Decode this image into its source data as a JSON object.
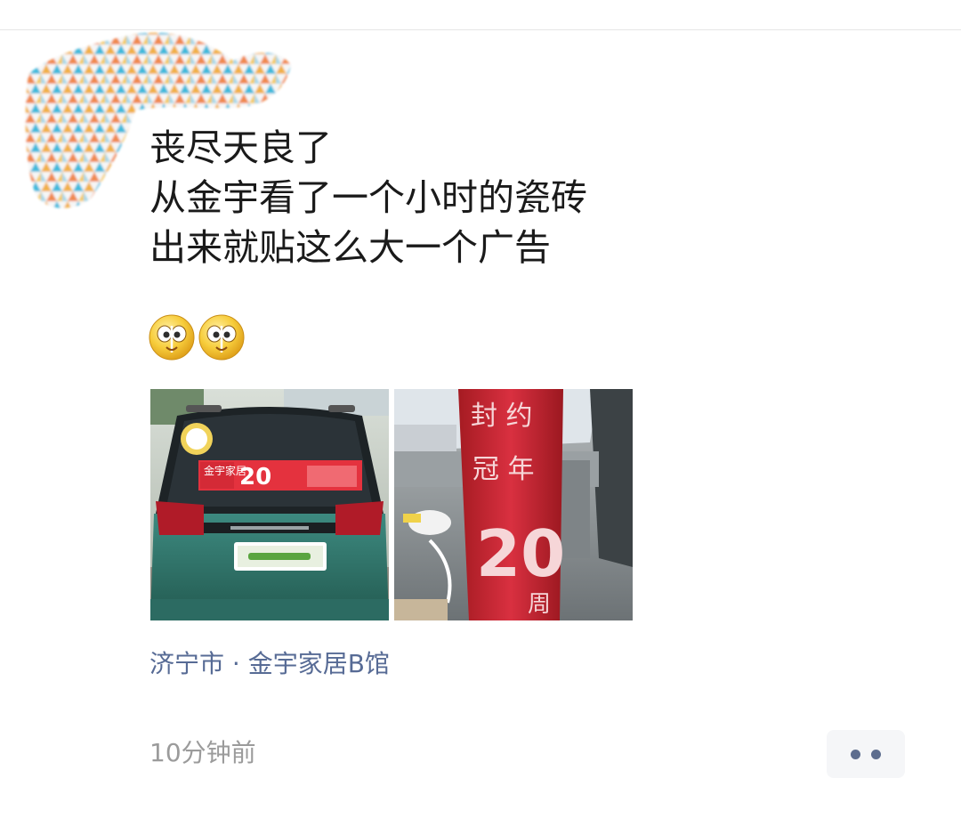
{
  "post": {
    "lines": [
      "丧尽天良了",
      "从金宇看了一个小时的瓷砖",
      "出来就贴这么大一个广告"
    ],
    "emojis": [
      "dizzy-face-emoji",
      "dizzy-face-emoji"
    ],
    "photos": [
      {
        "description": "car-rear-with-ad-sticker",
        "ad_brand": "金宇家居",
        "ad_number": "20"
      },
      {
        "description": "red-banner-in-car",
        "banner_number": "20",
        "banner_text": "周"
      }
    ],
    "location": "济宁市 · 金宇家居B馆",
    "timestamp": "10分钟前"
  },
  "colors": {
    "text": "#1a1a1a",
    "link": "#576b95",
    "meta": "#9b9b9b",
    "more_bg": "#f5f6f8",
    "more_dots": "#5d6d8e"
  },
  "icons": {
    "more": "more-dots-icon",
    "avatar": "avatar-pattern"
  }
}
